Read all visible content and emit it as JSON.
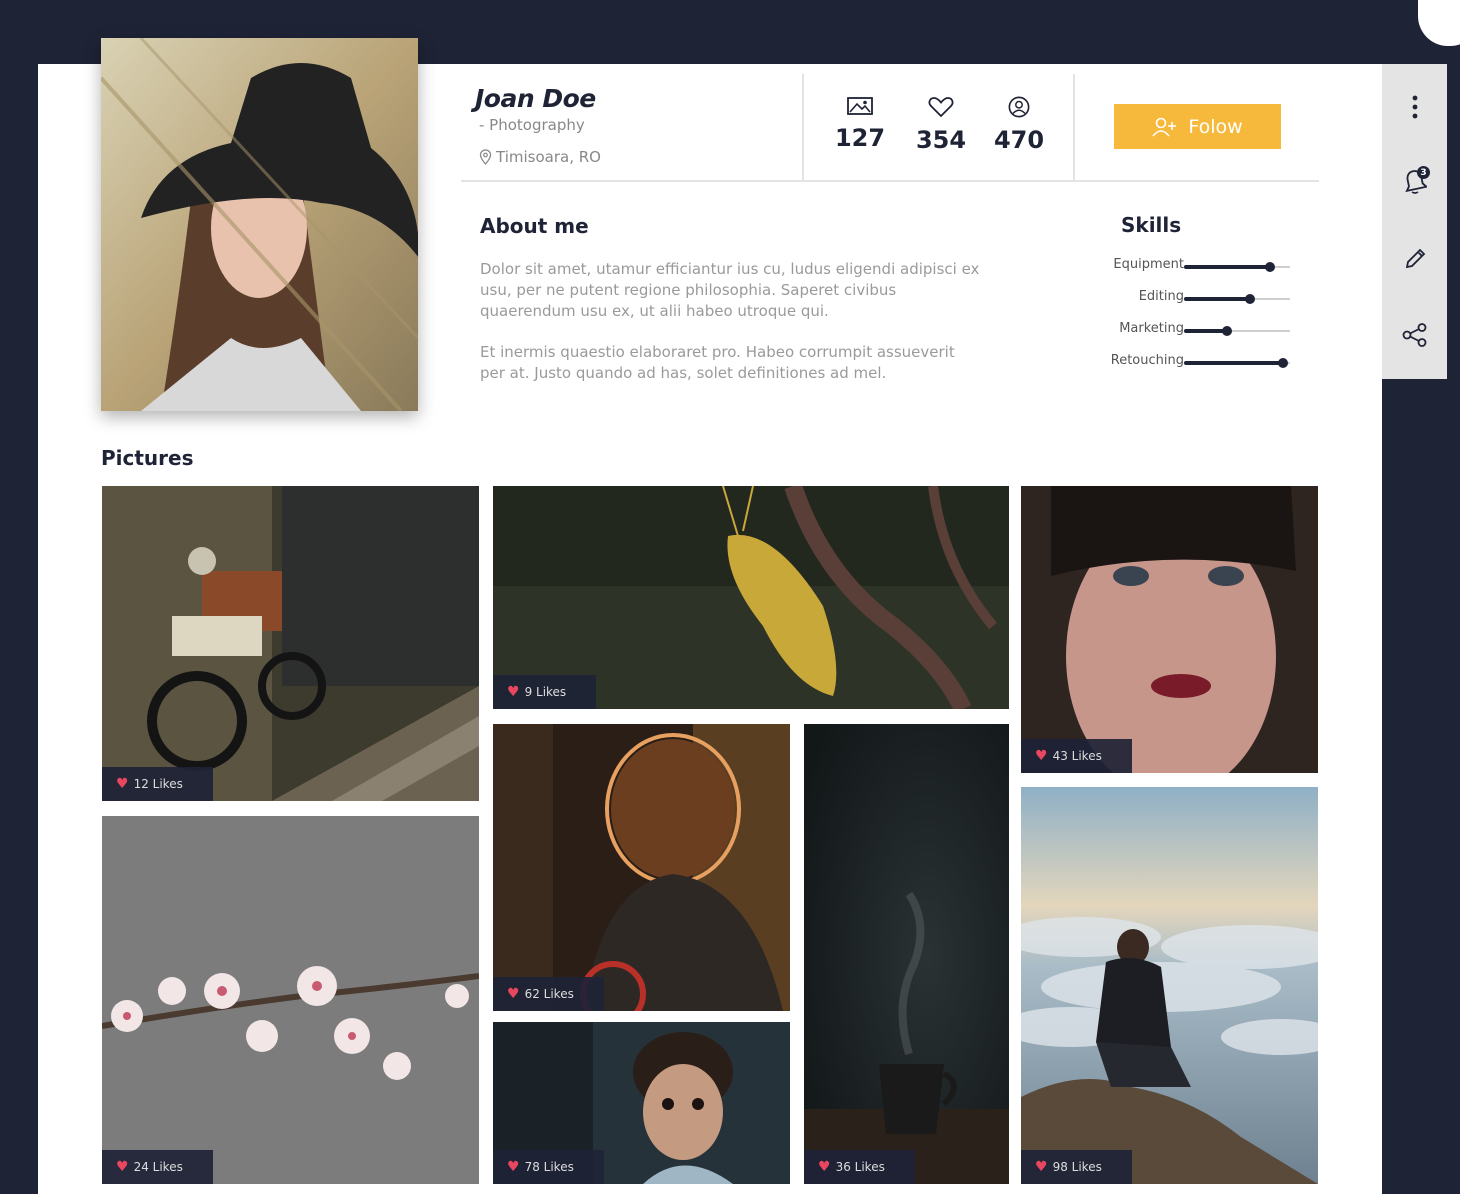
{
  "profile": {
    "name": "Joan Doe",
    "role": "- Photography",
    "location": "Timisoara, RO"
  },
  "stats": [
    {
      "icon": "image-icon",
      "value": "127"
    },
    {
      "icon": "heart-icon",
      "value": "354"
    },
    {
      "icon": "user-icon",
      "value": "470"
    }
  ],
  "follow": {
    "label": "Folow",
    "icon": "add-user-icon"
  },
  "about": {
    "title": "About me",
    "paragraph1": "Dolor sit amet, utamur efficiantur ius cu, ludus eligendi adipisci ex usu, per ne putent regione philosophia. Saperet civibus quaerendum usu ex, ut alii habeo utroque qui.",
    "paragraph2": "Et inermis quaestio elaboraret pro. Habeo corrumpit assueverit per at. Justo quando ad has, solet definitiones ad mel."
  },
  "skills": {
    "title": "Skills",
    "items": [
      {
        "label": "Equipment",
        "level": 0.81
      },
      {
        "label": "Editing",
        "level": 0.62
      },
      {
        "label": "Marketing",
        "level": 0.41
      },
      {
        "label": "Retouching",
        "level": 0.93
      }
    ]
  },
  "side_actions": {
    "notification_count": "3",
    "icons": [
      "more-vertical-icon",
      "bell-icon",
      "pencil-icon",
      "share-icon"
    ]
  },
  "pictures": {
    "title": "Pictures",
    "items": [
      {
        "subject": "motorcycle",
        "likes": "12 Likes"
      },
      {
        "subject": "grasshopper",
        "likes": "9 Likes"
      },
      {
        "subject": "woman-portrait",
        "likes": "43 Likes"
      },
      {
        "subject": "cherry-blossom",
        "likes": "24 Likes"
      },
      {
        "subject": "girl-sunlight",
        "likes": "62 Likes"
      },
      {
        "subject": "coffee-cup",
        "likes": "36 Likes"
      },
      {
        "subject": "man-clouds",
        "likes": "98 Likes"
      },
      {
        "subject": "child",
        "likes": "78 Likes"
      }
    ]
  },
  "colors": {
    "background": "#1e2336",
    "accent": "#f6b93b",
    "heart": "#e8475f"
  }
}
